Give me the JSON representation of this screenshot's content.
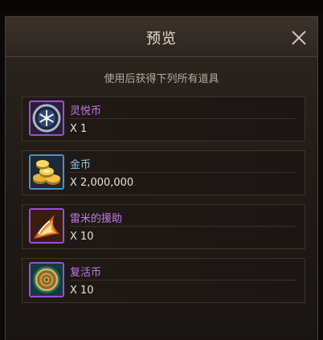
{
  "dialog": {
    "title": "预览",
    "subtitle": "使用后获得下列所有道具"
  },
  "items": [
    {
      "name": "灵悦币",
      "qty": "X 1",
      "name_color": "#c07be8",
      "frame_color": "#9b4fd0",
      "icon": "snowflake-coin-icon"
    },
    {
      "name": "金币",
      "qty": "X 2,000,000",
      "name_color": "#8ec9ea",
      "frame_color": "#4f8fc2",
      "icon": "gold-coins-icon"
    },
    {
      "name": "雷米的援助",
      "qty": "X 10",
      "name_color": "#c07be8",
      "frame_color": "#9b4fd0",
      "icon": "flaming-hand-icon"
    },
    {
      "name": "复活币",
      "qty": "X 10",
      "name_color": "#c07be8",
      "frame_color": "#9b4fd0",
      "icon": "revive-coin-icon"
    }
  ],
  "colors": {
    "title": "#e7dccd",
    "subtitle": "#b6ab9d"
  }
}
